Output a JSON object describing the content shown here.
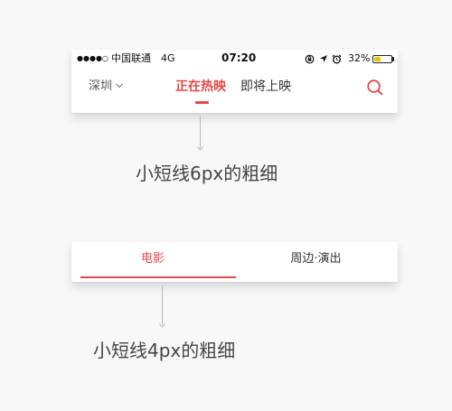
{
  "colors": {
    "accent": "#e54847",
    "text_dark": "#333333",
    "text_muted": "#555555",
    "battery": "#f2c200",
    "background": "#f8f8f8"
  },
  "status_bar": {
    "signal": "●●●●○",
    "carrier": "中国联通",
    "network": "4G",
    "time": "07:20",
    "battery_percent_label": "32%",
    "battery_level": 0.32,
    "icons": [
      "lock-rotation-icon",
      "location-arrow-icon",
      "alarm-icon"
    ]
  },
  "top_nav": {
    "city": "深圳",
    "tabs": [
      {
        "label": "正在热映",
        "active": true
      },
      {
        "label": "即将上映",
        "active": false
      }
    ],
    "search_icon": "search-icon"
  },
  "annotations": {
    "top": "小短线6px的粗细",
    "bottom": "小短线4px的粗细"
  },
  "sub_tabs": {
    "tabs": [
      {
        "label": "电影",
        "active": true
      },
      {
        "label": "周边·演出",
        "active": false
      }
    ]
  }
}
